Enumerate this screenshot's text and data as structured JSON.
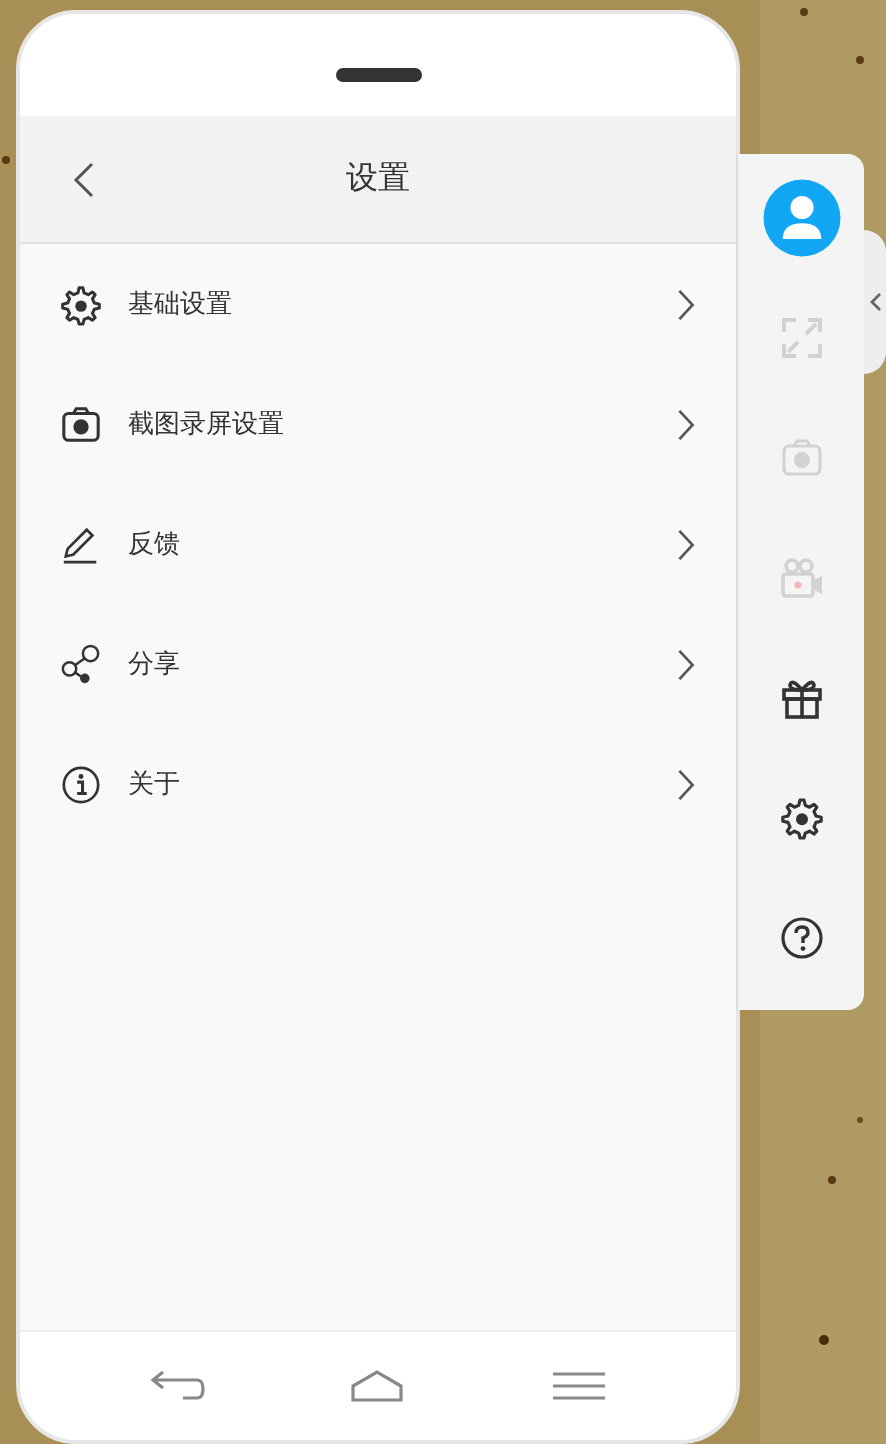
{
  "header": {
    "title": "设置"
  },
  "menu": [
    {
      "kind": "gear",
      "label": "基础设置"
    },
    {
      "kind": "camera",
      "label": "截图录屏设置"
    },
    {
      "kind": "pen",
      "label": "反馈"
    },
    {
      "kind": "share",
      "label": "分享"
    },
    {
      "kind": "info",
      "label": "关于"
    }
  ],
  "toolbar": [
    {
      "kind": "avatar",
      "disabled": false
    },
    {
      "kind": "fullscreen",
      "disabled": true
    },
    {
      "kind": "camera",
      "disabled": true
    },
    {
      "kind": "video",
      "disabled": true
    },
    {
      "kind": "gift",
      "disabled": false
    },
    {
      "kind": "gear",
      "disabled": false
    },
    {
      "kind": "help",
      "disabled": false
    }
  ],
  "nav_bar": [
    {
      "kind": "back"
    },
    {
      "kind": "home"
    },
    {
      "kind": "menu"
    }
  ]
}
